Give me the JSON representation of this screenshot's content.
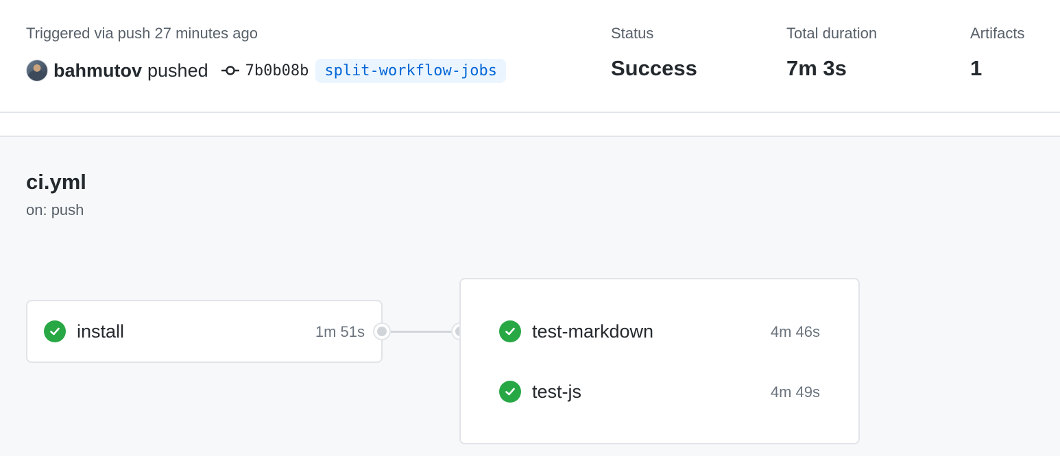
{
  "run": {
    "trigger_text": "Triggered via push 27 minutes ago",
    "actor": "bahmutov",
    "action": "pushed",
    "commit_sha": "7b0b08b",
    "branch": "split-workflow-jobs"
  },
  "stats": {
    "status_label": "Status",
    "status_value": "Success",
    "duration_label": "Total duration",
    "duration_value": "7m 3s",
    "artifacts_label": "Artifacts",
    "artifacts_value": "1"
  },
  "workflow": {
    "name": "ci.yml",
    "trigger": "on: push",
    "jobs": [
      {
        "name": "install",
        "duration": "1m 51s",
        "status": "success"
      },
      {
        "name": "test-markdown",
        "duration": "4m 46s",
        "status": "success"
      },
      {
        "name": "test-js",
        "duration": "4m 49s",
        "status": "success"
      }
    ]
  },
  "colors": {
    "success": "#28a745",
    "link": "#0366d6",
    "branch_bg": "#eaf5ff"
  },
  "icons": {
    "avatar": "avatar",
    "commit": "git-commit-icon",
    "success": "check-circle-icon"
  }
}
